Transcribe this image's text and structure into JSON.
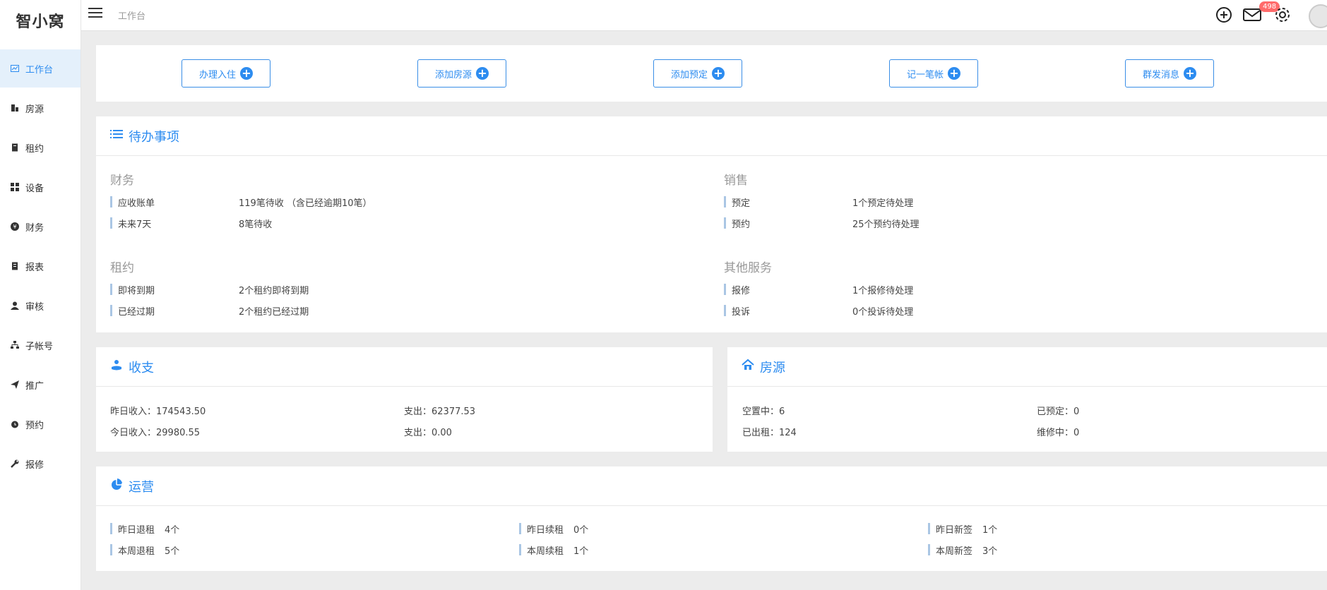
{
  "app": {
    "logo": "智小窝"
  },
  "sidebar": {
    "items": [
      {
        "label": "工作台"
      },
      {
        "label": "房源"
      },
      {
        "label": "租约"
      },
      {
        "label": "设备"
      },
      {
        "label": "财务"
      },
      {
        "label": "报表"
      },
      {
        "label": "审核"
      },
      {
        "label": "子帐号"
      },
      {
        "label": "推广"
      },
      {
        "label": "预约"
      },
      {
        "label": "报修"
      }
    ]
  },
  "header": {
    "breadcrumb": "工作台",
    "mail_badge": "498"
  },
  "quick_actions": [
    {
      "label": "办理入住"
    },
    {
      "label": "添加房源"
    },
    {
      "label": "添加预定"
    },
    {
      "label": "记一笔帐"
    },
    {
      "label": "群发消息"
    }
  ],
  "todo": {
    "title": "待办事项",
    "finance": {
      "title": "财务",
      "rows": [
        {
          "label": "应收账单",
          "value": "119笔待收 （含已经逾期10笔）"
        },
        {
          "label": "未来7天",
          "value": "8笔待收"
        }
      ]
    },
    "sales": {
      "title": "销售",
      "rows": [
        {
          "label": "预定",
          "value": "1个预定待处理"
        },
        {
          "label": "预约",
          "value": "25个预约待处理"
        }
      ]
    },
    "lease": {
      "title": "租约",
      "rows": [
        {
          "label": "即将到期",
          "value": "2个租约即将到期"
        },
        {
          "label": "已经过期",
          "value": "2个租约已经过期"
        }
      ]
    },
    "other": {
      "title": "其他服务",
      "rows": [
        {
          "label": "报修",
          "value": "1个报修待处理"
        },
        {
          "label": "投诉",
          "value": "0个投诉待处理"
        }
      ]
    }
  },
  "income": {
    "title": "收支",
    "yesterday_income": "昨日收入：174543.50",
    "yesterday_expense": "支出：62377.53",
    "today_income": "今日收入：29980.55",
    "today_expense": "支出：0.00"
  },
  "housing": {
    "title": "房源",
    "vacant": "空置中：6",
    "reserved": "已预定：0",
    "rented": "已出租：124",
    "repairing": "维修中：0"
  },
  "operations": {
    "title": "运营",
    "items": [
      {
        "label": "昨日退租",
        "value": "4个"
      },
      {
        "label": "本周退租",
        "value": "5个"
      },
      {
        "label": "昨日续租",
        "value": "0个"
      },
      {
        "label": "本周续租",
        "value": "1个"
      },
      {
        "label": "昨日新签",
        "value": "1个"
      },
      {
        "label": "本周新签",
        "value": "3个"
      }
    ]
  },
  "colors": {
    "accent": "#2d8cf0",
    "badge": "#ff6b6b",
    "row_bar": "#aac6e4"
  }
}
